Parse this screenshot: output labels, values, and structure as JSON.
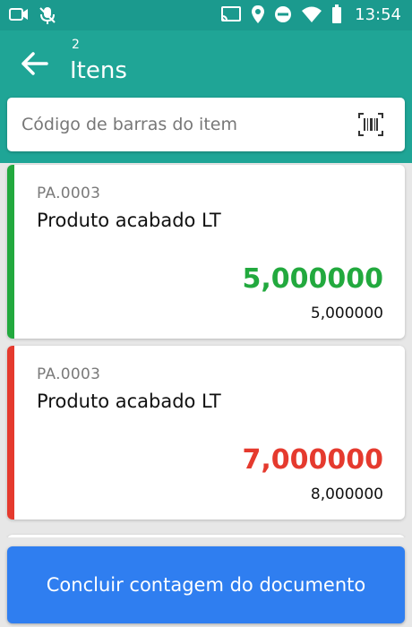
{
  "status_bar": {
    "time": "13:54",
    "icons": [
      "video-camera-icon",
      "mic-icon",
      "cast-icon",
      "location-icon",
      "do-not-disturb-icon",
      "wifi-icon",
      "battery-icon"
    ]
  },
  "app_bar": {
    "count": "2",
    "title": "Itens"
  },
  "search": {
    "placeholder": "Código de barras do item"
  },
  "items": [
    {
      "code": "PA.0003",
      "name": "Produto acabado LT",
      "counted": "5,000000",
      "expected": "5,000000",
      "status_color": "#22a93e"
    },
    {
      "code": "PA.0003",
      "name": "Produto acabado LT",
      "counted": "7,000000",
      "expected": "8,000000",
      "status_color": "#e53a2e"
    }
  ],
  "footer": {
    "conclude_label": "Concluir contagem do documento"
  },
  "colors": {
    "primary": "#1fa596",
    "status_bar": "#1b9a8e",
    "button": "#2f7ef0",
    "match": "#22a93e",
    "mismatch": "#e53a2e"
  }
}
